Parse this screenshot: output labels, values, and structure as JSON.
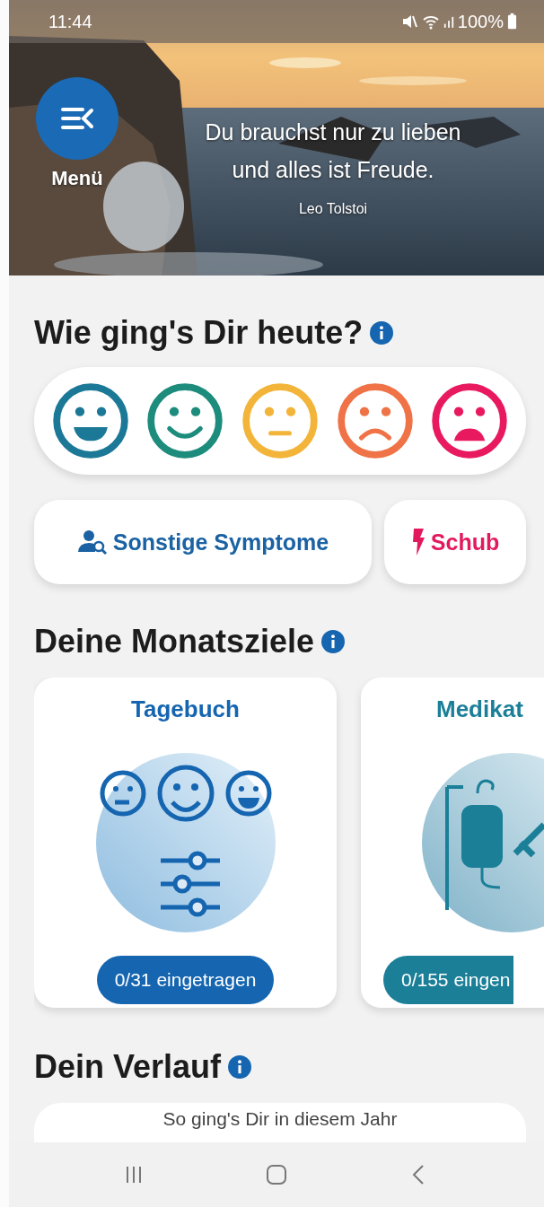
{
  "status_bar": {
    "time": "11:44",
    "battery": "100%"
  },
  "header": {
    "menu_label": "Menü",
    "quote_lines": [
      "Du brauchst nur zu lieben",
      "und alles ist Freude."
    ],
    "author": "Leo Tolstoi"
  },
  "mood": {
    "title": "Wie ging's Dir heute?",
    "options": [
      {
        "kind": "very-happy",
        "color": "#1b7896"
      },
      {
        "kind": "happy",
        "color": "#1d8c7c"
      },
      {
        "kind": "neutral",
        "color": "#f3b43a"
      },
      {
        "kind": "sad",
        "color": "#ef7347"
      },
      {
        "kind": "very-sad",
        "color": "#e8195e"
      }
    ]
  },
  "actions": [
    {
      "kind": "symptoms",
      "label": "Sonstige Symptome",
      "color": "#1a62a3"
    },
    {
      "kind": "flare",
      "label": "Schub",
      "color": "#e3195e"
    }
  ],
  "goals": {
    "title": "Deine Monatsziele",
    "cards": [
      {
        "kind": "diary",
        "title": "Tagebuch",
        "progress": "0/31 eingetragen",
        "color": "#1565b0"
      },
      {
        "kind": "medication",
        "title": "Medikat",
        "progress": "0/155 eingen",
        "color": "#1b7f98"
      }
    ]
  },
  "history": {
    "title": "Dein Verlauf",
    "subtitle": "So ging's Dir in diesem Jahr"
  }
}
